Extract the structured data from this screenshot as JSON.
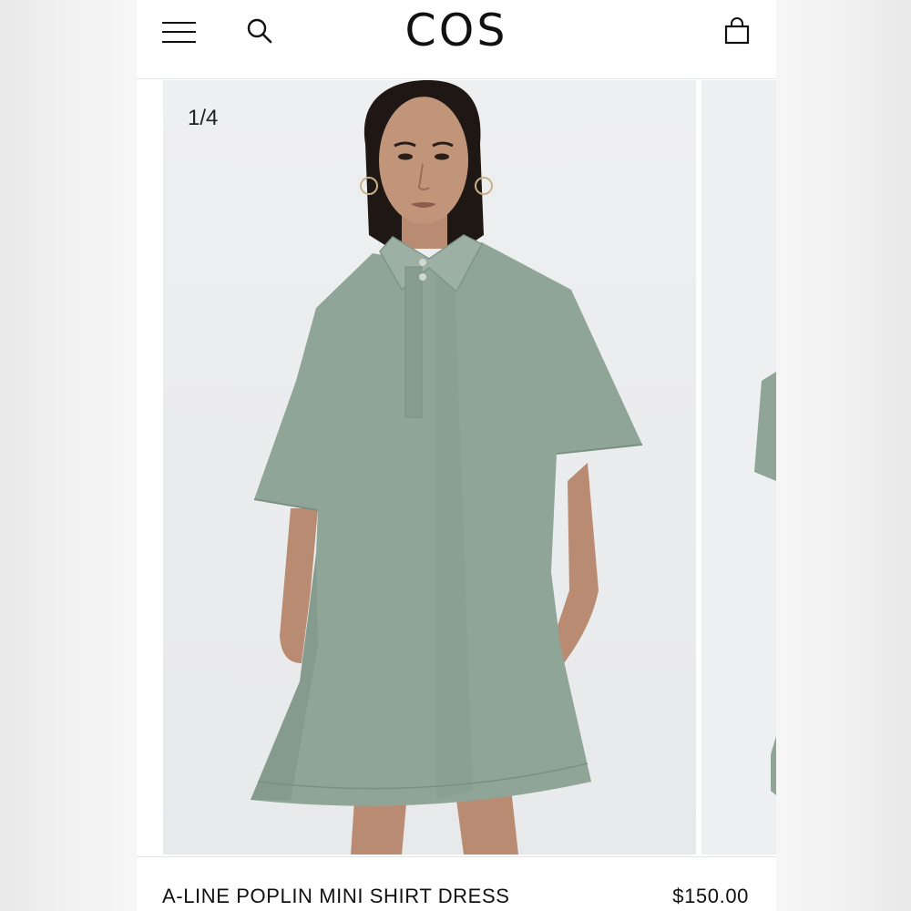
{
  "header": {
    "brand": "COS",
    "menu_icon": "hamburger-menu-icon",
    "search_icon": "search-icon",
    "bag_icon": "shopping-bag-icon"
  },
  "gallery": {
    "counter": "1/4"
  },
  "product": {
    "name": "A-LINE POPLIN MINI SHIRT DRESS",
    "price": "$150.00"
  },
  "colors": {
    "dress": "#8fa597",
    "background": "#ffffff",
    "text": "#111111"
  }
}
